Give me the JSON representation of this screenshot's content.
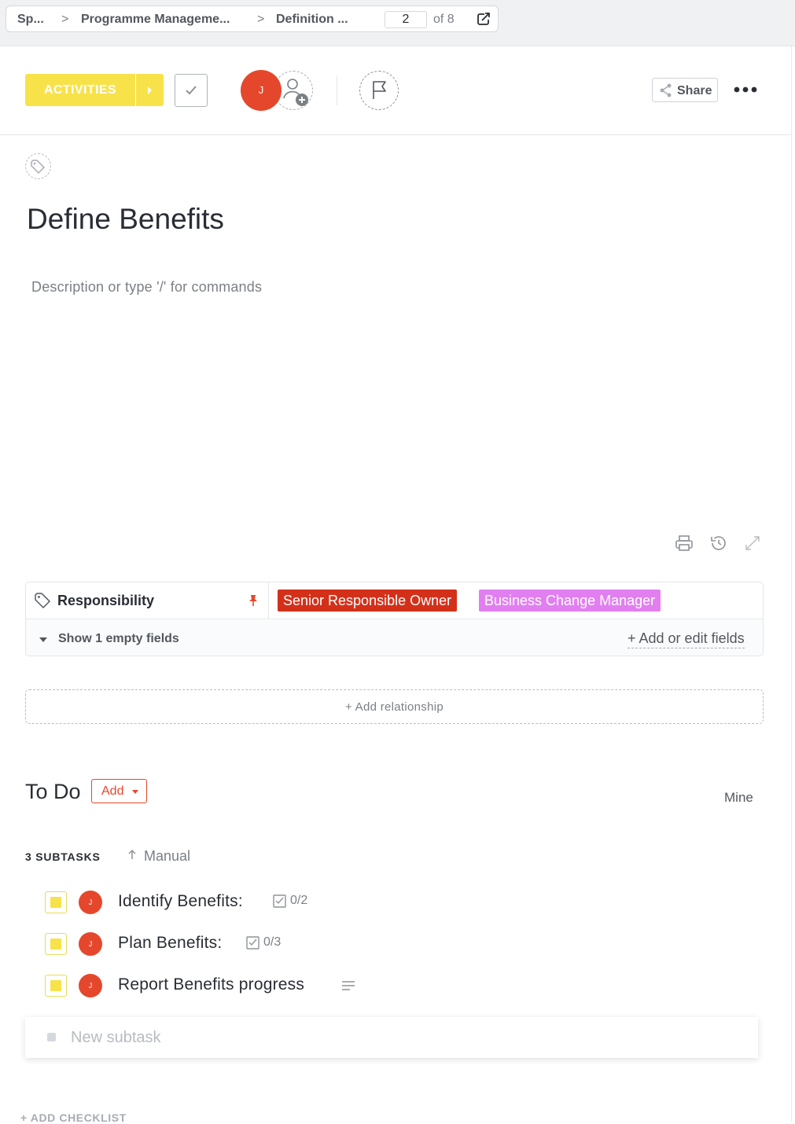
{
  "breadcrumb": {
    "items": [
      "Sp...",
      "Programme Manageme...",
      "Definition ..."
    ],
    "separator": ">",
    "current_page": "2",
    "page_total": "of 8"
  },
  "toolbar": {
    "status_label": "ACTIVITIES",
    "status_color": "#f7e24a",
    "assignee_initial": "J",
    "share_label": "Share"
  },
  "task": {
    "title": "Define Benefits",
    "description_placeholder": "Description or type '/' for commands"
  },
  "fields": {
    "responsibility_label": "Responsibility",
    "values": [
      {
        "label": "Senior Responsible Owner",
        "color": "#d3301a"
      },
      {
        "label": "Business Change Manager",
        "color": "#e17ff0"
      }
    ],
    "show_empty_label": "Show 1 empty fields",
    "add_edit_label": "+ Add or edit fields"
  },
  "relationship": {
    "label": "+ Add relationship"
  },
  "todo": {
    "title": "To Do",
    "add_label": "Add",
    "mine_label": "Mine",
    "subtasks_count": "3 SUBTASKS",
    "sort_label": "Manual",
    "subtasks": [
      {
        "name": "Identify Benefits:",
        "avatar": "J",
        "checklist": "0/2"
      },
      {
        "name": "Plan Benefits:",
        "avatar": "J",
        "checklist": "0/3"
      },
      {
        "name": "Report Benefits progress",
        "avatar": "J"
      }
    ],
    "new_subtask_placeholder": "New subtask",
    "add_checklist_label": "+ ADD CHECKLIST"
  }
}
